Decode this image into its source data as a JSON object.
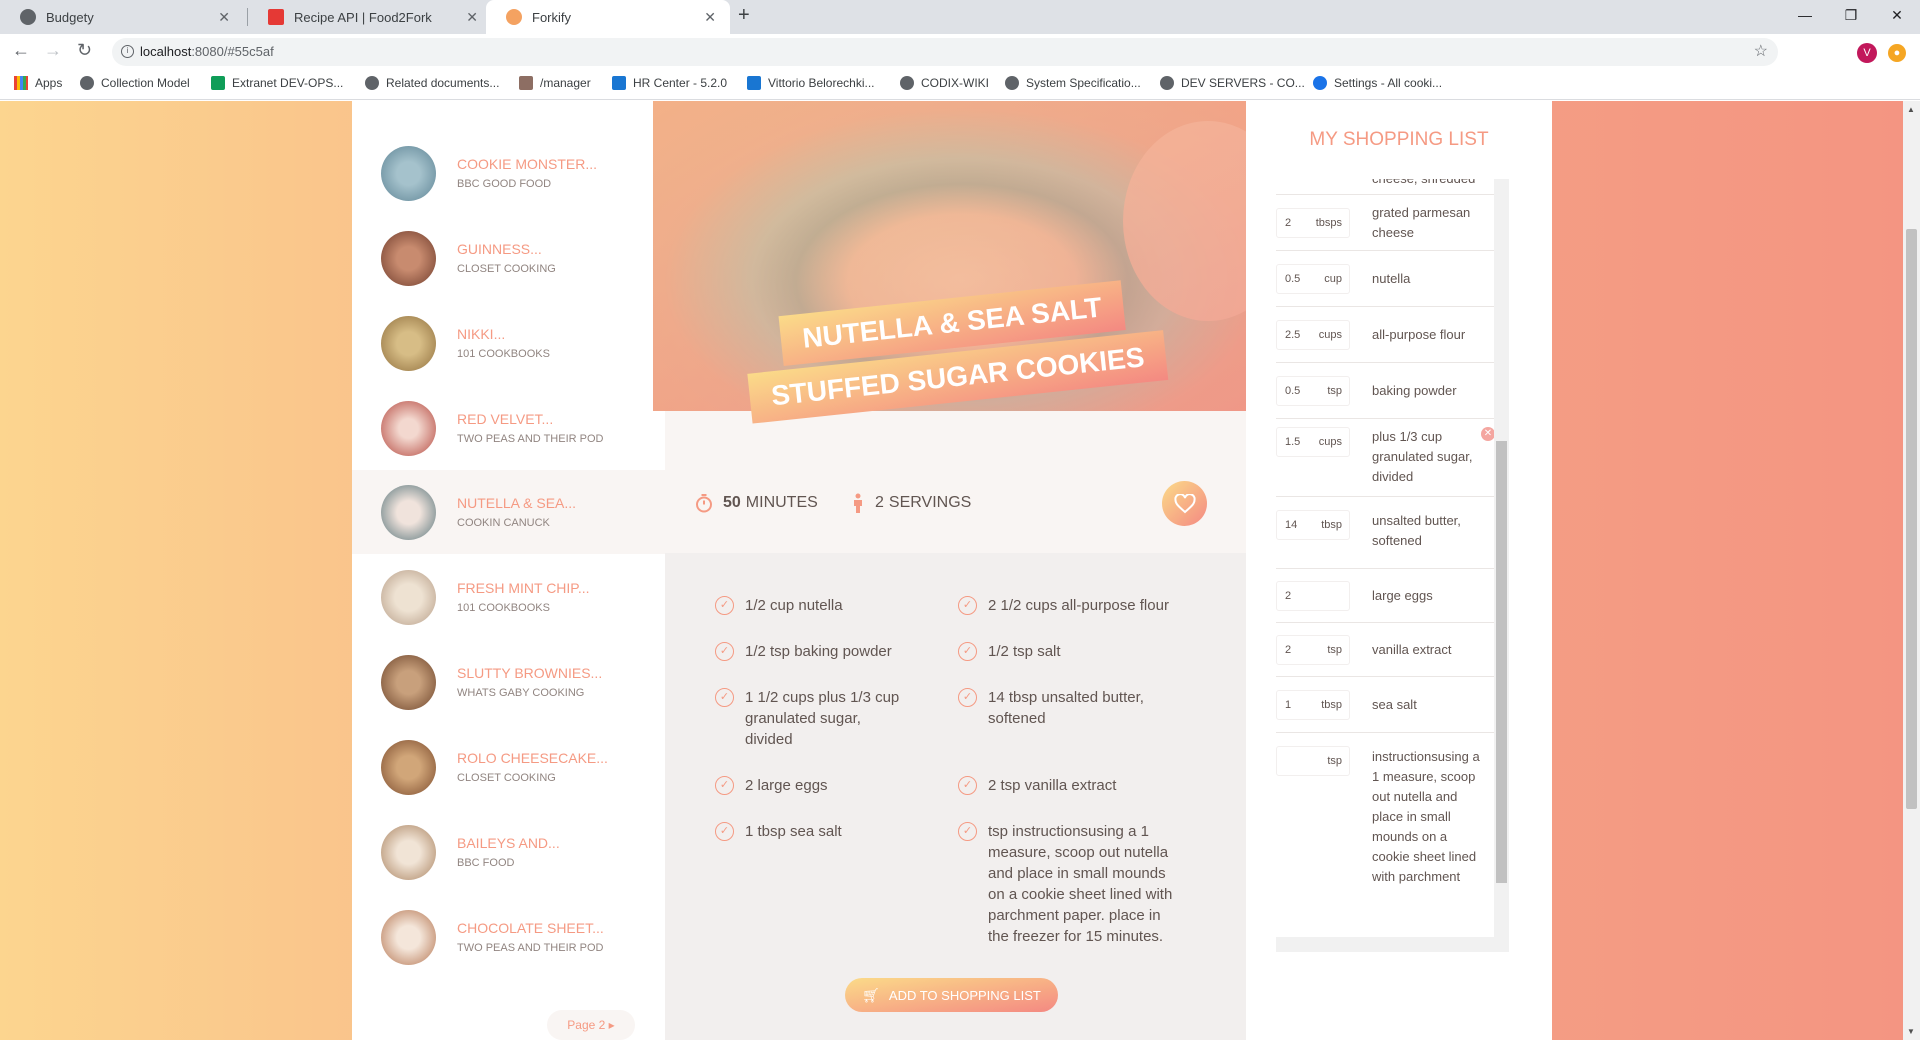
{
  "browser": {
    "tabs": [
      {
        "title": "Budgety",
        "icon_color": "#5f6368"
      },
      {
        "title": "Recipe API | Food2Fork",
        "icon_color": "#e53935"
      },
      {
        "title": "Forkify",
        "icon_color": "#f4a261"
      }
    ],
    "url_host": "localhost",
    "url_path": ":8080/#55c5af",
    "avatar_letter": "V",
    "bookmarks": [
      "Apps",
      "Collection Model",
      "Extranet DEV-OPS...",
      "Related documents...",
      "/manager",
      "HR Center -  5.2.0",
      "Vittorio Belorechki...",
      "CODIX-WIKI",
      "System Specificatio...",
      "DEV SERVERS - CO...",
      "Settings - All cooki..."
    ]
  },
  "results": {
    "items": [
      {
        "title": "COOKIE MONSTER...",
        "author": "BBC GOOD FOOD",
        "img": "#7fa6b5"
      },
      {
        "title": "GUINNESS...",
        "author": "CLOSET COOKING",
        "img": "#8c5545"
      },
      {
        "title": "NIKKI...",
        "author": "101 COOKBOOKS",
        "img": "#b99a63"
      },
      {
        "title": "RED VELVET...",
        "author": "TWO PEAS AND THEIR POD",
        "img": "#c96b5f"
      },
      {
        "title": "NUTELLA & SEA...",
        "author": "COOKIN CANUCK",
        "img": "#7c8e90"
      },
      {
        "title": "FRESH MINT CHIP...",
        "author": "101 COOKBOOKS",
        "img": "#d6c2ad"
      },
      {
        "title": "SLUTTY BROWNIES...",
        "author": "WHATS GABY COOKING",
        "img": "#8b5e3f"
      },
      {
        "title": "ROLO CHEESECAKE...",
        "author": "CLOSET COOKING",
        "img": "#9a6242"
      },
      {
        "title": "BAILEYS AND...",
        "author": "BBC FOOD",
        "img": "#c9a98a"
      },
      {
        "title": "CHOCOLATE SHEET...",
        "author": "TWO PEAS AND THEIR POD",
        "img": "#c79374"
      }
    ],
    "active_index": 4,
    "next_page": "Page 2"
  },
  "recipe": {
    "title_line1": "NUTELLA & SEA SALT",
    "title_line2": "STUFFED SUGAR COOKIES",
    "minutes": "50",
    "minutes_label": "MINUTES",
    "servings": "2",
    "servings_label": "SERVINGS",
    "ingredients": [
      "1/2 cup nutella",
      "2 1/2 cups all-purpose flour",
      "1/2 tsp baking powder",
      "1/2 tsp salt",
      "1 1/2 cups plus 1/3 cup granulated sugar, divided",
      "14 tbsp unsalted butter, softened",
      "2 large eggs",
      "2 tsp vanilla extract",
      "1 tbsp sea salt",
      "tsp instructionsusing a 1 measure, scoop out nutella and place in small mounds on a cookie sheet lined with parchment paper. place in the freezer for 15 minutes."
    ],
    "add_to_list": "ADD TO SHOPPING LIST"
  },
  "shopping": {
    "title": "MY SHOPPING LIST",
    "partial_top": "cheese, shredded",
    "items": [
      {
        "count": "2",
        "unit": "tbsps",
        "desc": "grated parmesan cheese"
      },
      {
        "count": "0.5",
        "unit": "cup",
        "desc": "nutella"
      },
      {
        "count": "2.5",
        "unit": "cups",
        "desc": "all-purpose flour"
      },
      {
        "count": "0.5",
        "unit": "tsp",
        "desc": "baking powder"
      },
      {
        "count": "1.5",
        "unit": "cups",
        "desc": "plus 1/3 cup granulated sugar, divided"
      },
      {
        "count": "14",
        "unit": "tbsp",
        "desc": "unsalted butter, softened"
      },
      {
        "count": "2",
        "unit": "",
        "desc": "large eggs"
      },
      {
        "count": "2",
        "unit": "tsp",
        "desc": "vanilla extract"
      },
      {
        "count": "1",
        "unit": "tbsp",
        "desc": "sea salt"
      },
      {
        "count": "",
        "unit": "tsp",
        "desc": "instructionsusing a 1 measure, scoop out nutella and place in small mounds on a cookie sheet lined with parchment"
      }
    ]
  }
}
